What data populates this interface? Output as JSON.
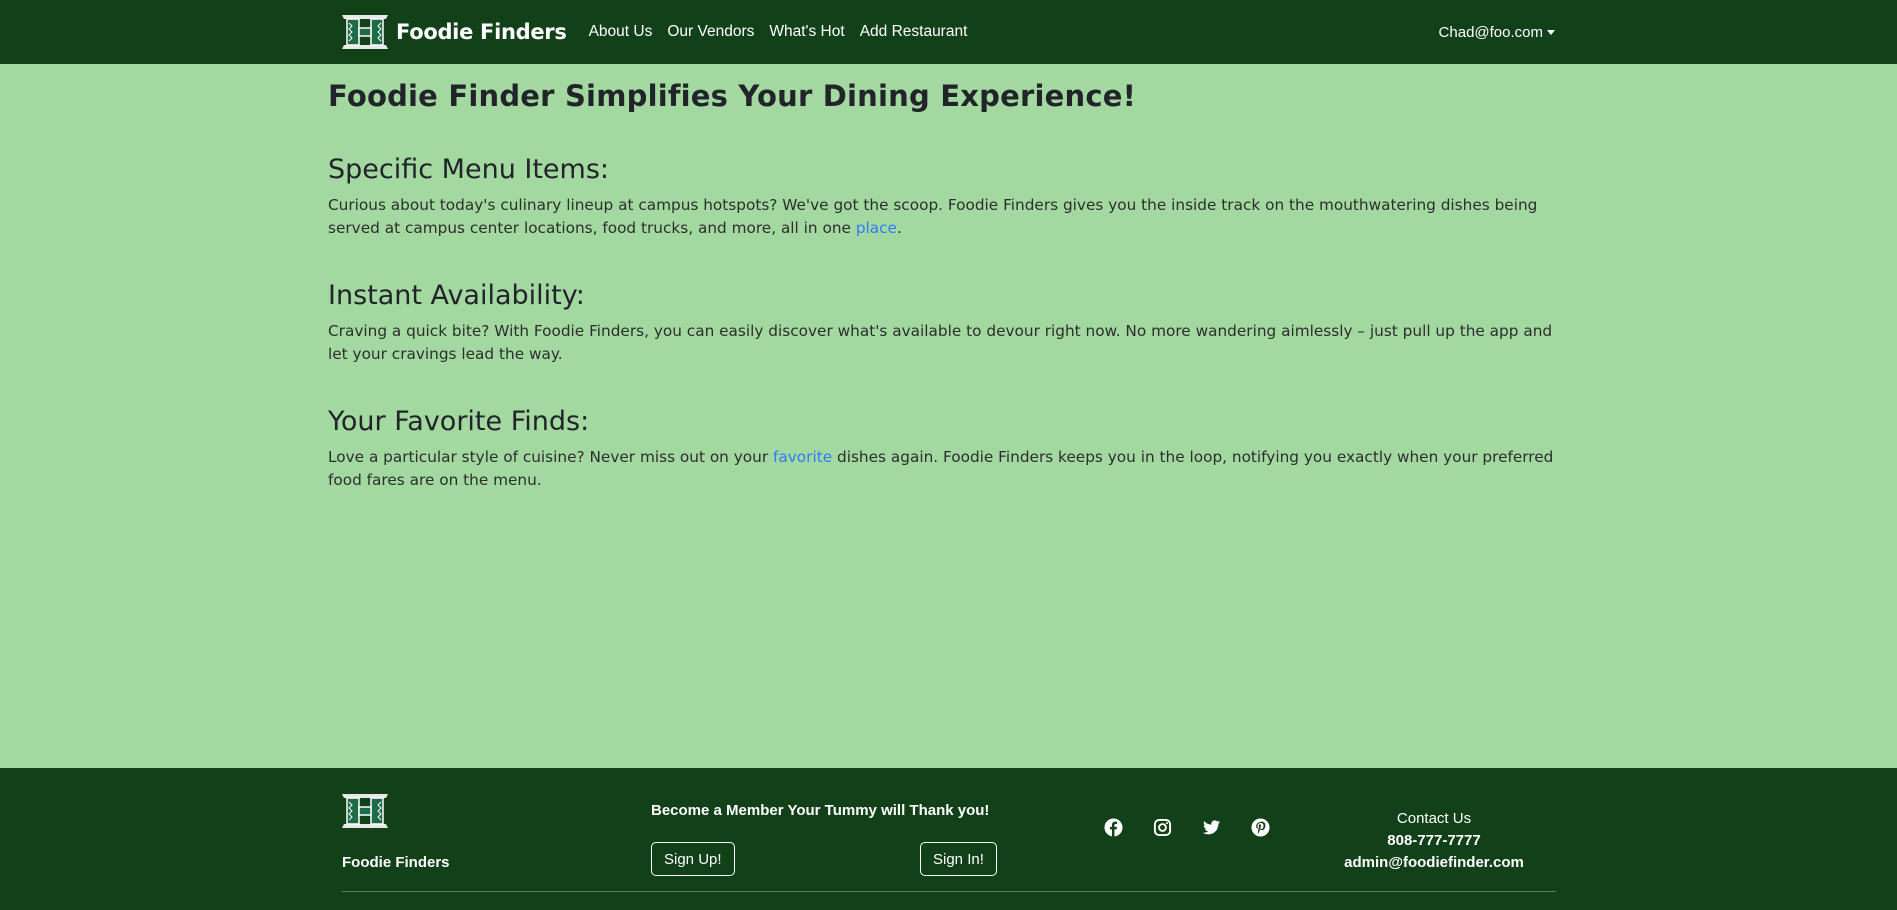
{
  "navbar": {
    "brand": "Foodie Finders",
    "logo_icon": "uh-h-logo-icon",
    "links": [
      "About Us",
      "Our Vendors",
      "What's Hot",
      "Add Restaurant"
    ],
    "user": "Chad@foo.com"
  },
  "main": {
    "title": "Foodie Finder Simplifies Your Dining Experience!",
    "sections": [
      {
        "title": "Specific Menu Items:",
        "body_before": "Curious about today's culinary lineup at campus hotspots? We've got the scoop. Foodie Finders gives you the inside track on the mouthwatering dishes being served at campus center locations, food trucks, and more, all in one ",
        "link": "place",
        "body_after": "."
      },
      {
        "title": "Instant Availability:",
        "body": "Craving a quick bite? With Foodie Finders, you can easily discover what's available to devour right now. No more wandering aimlessly – just pull up the app and let your cravings lead the way."
      },
      {
        "title": "Your Favorite Finds:",
        "body_before": "Love a particular style of cuisine? Never miss out on your ",
        "link": "favorite",
        "body_after": " dishes again. Foodie Finders keeps you in the loop, notifying you exactly when your preferred food fares are on the menu."
      }
    ]
  },
  "footer": {
    "brand": "Foodie Finders",
    "member_text": "Become a Member Your Tummy will Thank you!",
    "signup_label": "Sign Up!",
    "signin_label": "Sign In!",
    "socials": [
      "facebook-icon",
      "instagram-icon",
      "twitter-icon",
      "pinterest-icon"
    ],
    "contact_title": "Contact Us",
    "phone": "808-777-7777",
    "email": "admin@foodiefinder.com"
  },
  "colors": {
    "nav_bg": "#124119",
    "page_bg": "#a3d9a1",
    "link": "#2f7cf6"
  }
}
